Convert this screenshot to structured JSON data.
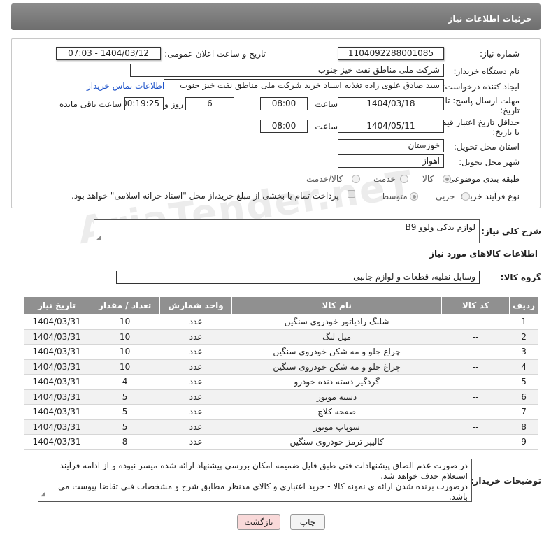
{
  "header": {
    "title": "جزئیات اطلاعات نیاز"
  },
  "form": {
    "need_number_label": "شماره نیاز:",
    "need_number": "1104092288001085",
    "announce_label": "تاریخ و ساعت اعلان عمومی:",
    "announce_value": "1404/03/12 - 07:03",
    "buyer_org_label": "نام دستگاه خریدار:",
    "buyer_org": "شرکت ملی مناطق نفت خیز جنوب",
    "requester_label": "ایجاد کننده درخواست:",
    "requester": "سید صادق علوی زاده  تغذیه اسناد خرید  شرکت ملی مناطق نفت خیز جنوب",
    "contact_link": "اطلاعات تماس خریدار",
    "deadline_label_1": "مهلت ارسال پاسخ: تا",
    "deadline_label_2": "تاریخ:",
    "deadline_date": "1404/03/18",
    "time_label": "ساعت",
    "deadline_time": "08:00",
    "days_value": "6",
    "days_label": "روز و",
    "remaining_time": "00:19:25",
    "remaining_label": "ساعت باقی مانده",
    "validity_label_1": "حداقل تاریخ اعتبار قیمت:",
    "validity_label_2": "تا تاریخ:",
    "validity_date": "1404/05/11",
    "validity_time": "08:00",
    "province_label": "استان محل تحویل:",
    "province": "خوزستان",
    "city_label": "شهر محل تحویل:",
    "city": "اهواز",
    "category_label": "طبقه بندی موضوعی:",
    "category_options": [
      "کالا",
      "خدمت",
      "کالا/خدمت"
    ],
    "process_label": "نوع فرآیند خرید :",
    "process_options": [
      "جزیی",
      "متوسط"
    ],
    "payment_note": "پرداخت تمام یا بخشی از مبلغ خرید،از محل \"اسناد خزانه اسلامی\" خواهد بود."
  },
  "description": {
    "label": "شرح کلی نیاز:",
    "value": "لوازم یدکی ولوو B9"
  },
  "goods_info": {
    "title": "اطلاعات کالاهای مورد نیاز",
    "group_label": "گروه کالا:",
    "group_value": "وسایل نقلیه، قطعات و لوازم جانبی"
  },
  "table": {
    "headers": [
      "ردیف",
      "کد کالا",
      "نام کالا",
      "واحد شمارش",
      "تعداد / مقدار",
      "تاریخ نیاز"
    ],
    "rows": [
      [
        "1",
        "--",
        "شلنگ رادیاتور خودروی سنگین",
        "عدد",
        "10",
        "1404/03/31"
      ],
      [
        "2",
        "--",
        "میل لنگ",
        "عدد",
        "10",
        "1404/03/31"
      ],
      [
        "3",
        "--",
        "چراغ جلو و مه شکن خودروی سنگین",
        "عدد",
        "10",
        "1404/03/31"
      ],
      [
        "4",
        "--",
        "چراغ جلو و مه شکن خودروی سنگین",
        "عدد",
        "10",
        "1404/03/31"
      ],
      [
        "5",
        "--",
        "گردگیر دسته دنده خودرو",
        "عدد",
        "4",
        "1404/03/31"
      ],
      [
        "6",
        "--",
        "دسته موتور",
        "عدد",
        "5",
        "1404/03/31"
      ],
      [
        "7",
        "--",
        "صفحه کلاچ",
        "عدد",
        "5",
        "1404/03/31"
      ],
      [
        "8",
        "--",
        "سوپاپ موتور",
        "عدد",
        "5",
        "1404/03/31"
      ],
      [
        "9",
        "--",
        "کالیپر ترمز خودروی سنگین",
        "عدد",
        "8",
        "1404/03/31"
      ]
    ]
  },
  "buyer_notes": {
    "label": "توضیحات خریدار:",
    "line1": "در صورت عدم الصاق پیشنهادات فنی طبق فایل ضمیمه امکان بررسی پیشنهاد ارائه شده میسر نبوده و از ادامه فرآیند",
    "line2": "استعلام حذف خواهد شد.",
    "line3": "درصورت برنده شدن ارائه ی نمونه کالا - خرید اعتباری و کالای مدنظر مطابق شرح و مشخصات فنی تقاضا پیوست می باشد."
  },
  "buttons": {
    "print": "چاپ",
    "back": "بازگشت"
  },
  "watermark": "AriaTender.neT",
  "colors": {
    "header_bg": "#7d7d7d",
    "link": "#1d52c9",
    "back_button_bg": "#f9d9d9"
  }
}
